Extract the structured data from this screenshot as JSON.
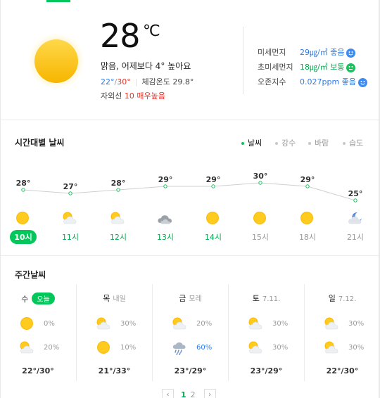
{
  "current": {
    "temperature": "28",
    "unit": "℃",
    "summary": "맑음, 어제보다 4° 높아요",
    "low": "22°",
    "high": "30°",
    "feels_label": "체감온도",
    "feels_value": "29.8°",
    "uv_label": "자외선",
    "uv_value": "10 매우높음",
    "icon": "sun-icon"
  },
  "air": [
    {
      "label": "미세먼지",
      "value": "29㎍/㎥ 좋음",
      "face": "smile-face-icon",
      "color": "#2f7ae5"
    },
    {
      "label": "초미세먼지",
      "value": "18㎍/㎥ 보통",
      "face": "neutral-face-icon",
      "color": "#03c75a"
    },
    {
      "label": "오존지수",
      "value": "0.027ppm 좋음",
      "face": "smile-face-icon",
      "color": "#2f7ae5"
    }
  ],
  "hourly": {
    "title": "시간대별 날씨",
    "tabs": [
      {
        "label": "날씨",
        "active": true
      },
      {
        "label": "강수",
        "active": false
      },
      {
        "label": "바람",
        "active": false
      },
      {
        "label": "습도",
        "active": false
      }
    ],
    "items": [
      {
        "time": "10시",
        "temp": "28°",
        "icon": "sun-icon",
        "now": true
      },
      {
        "time": "11시",
        "temp": "27°",
        "icon": "sun-cloud-icon",
        "green": true
      },
      {
        "time": "12시",
        "temp": "28°",
        "icon": "sun-cloud-icon",
        "green": true
      },
      {
        "time": "13시",
        "temp": "29°",
        "icon": "cloud-icon",
        "green": true
      },
      {
        "time": "14시",
        "temp": "29°",
        "icon": "sun-icon",
        "green": true
      },
      {
        "time": "15시",
        "temp": "30°",
        "icon": "sun-icon"
      },
      {
        "time": "18시",
        "temp": "29°",
        "icon": "sun-icon"
      },
      {
        "time": "21시",
        "temp": "25°",
        "icon": "moon-cloud-icon"
      }
    ]
  },
  "weekly": {
    "title": "주간날씨",
    "days": [
      {
        "day": "수",
        "sub": "",
        "today_badge": "오늘",
        "am_icon": "sun-icon",
        "am_pct": "0%",
        "pm_icon": "sun-cloud-icon",
        "pm_pct": "20%",
        "range": "22°/30°"
      },
      {
        "day": "목",
        "sub": "내일",
        "am_icon": "sun-cloud-icon",
        "am_pct": "30%",
        "pm_icon": "sun-icon",
        "pm_pct": "10%",
        "range": "21°/33°"
      },
      {
        "day": "금",
        "sub": "모레",
        "am_icon": "sun-cloud-icon",
        "am_pct": "20%",
        "pm_icon": "rain-cloud-icon",
        "pm_pct": "60%",
        "pm_blue": true,
        "range": "23°/29°"
      },
      {
        "day": "토",
        "sub": "7.11.",
        "am_icon": "sun-cloud-icon",
        "am_pct": "30%",
        "pm_icon": "sun-cloud-icon",
        "pm_pct": "30%",
        "range": "23°/29°"
      },
      {
        "day": "일",
        "sub": "7.12.",
        "am_icon": "sun-cloud-icon",
        "am_pct": "30%",
        "pm_icon": "sun-cloud-icon",
        "pm_pct": "30%",
        "range": "22°/30°"
      }
    ]
  },
  "pager": {
    "prev": "‹",
    "pages": [
      "1",
      "2"
    ],
    "current": "1",
    "next": "›"
  }
}
